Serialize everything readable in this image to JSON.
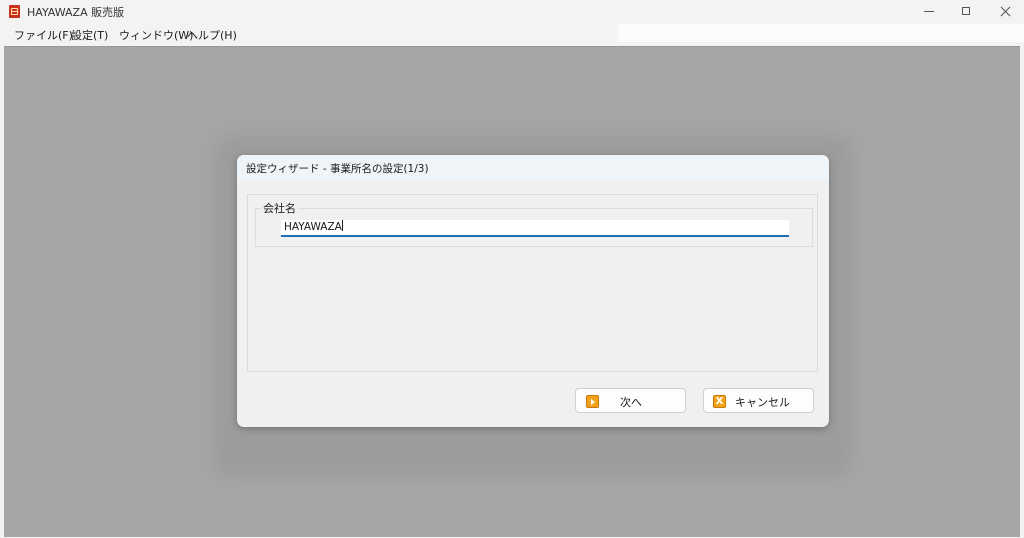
{
  "window": {
    "title": "HAYAWAZA 販売版"
  },
  "menubar": {
    "items": [
      {
        "label": "ファイル(F)"
      },
      {
        "label": "設定(T)"
      },
      {
        "label": "ウィンドウ(W)"
      },
      {
        "label": "ヘルプ(H)"
      }
    ]
  },
  "dialog": {
    "title": "設定ウィザード - 事業所名の設定(1/3)",
    "group_label": "会社名",
    "company_name_value": "HAYAWAZA",
    "next_label": "次へ",
    "cancel_label": "キャンセル"
  },
  "icons": {
    "app": "app-logo-icon",
    "next": "play-arrow-icon",
    "cancel": "x-icon",
    "accent_color": "#f3a21b",
    "focus_color": "#1d6fb8"
  }
}
